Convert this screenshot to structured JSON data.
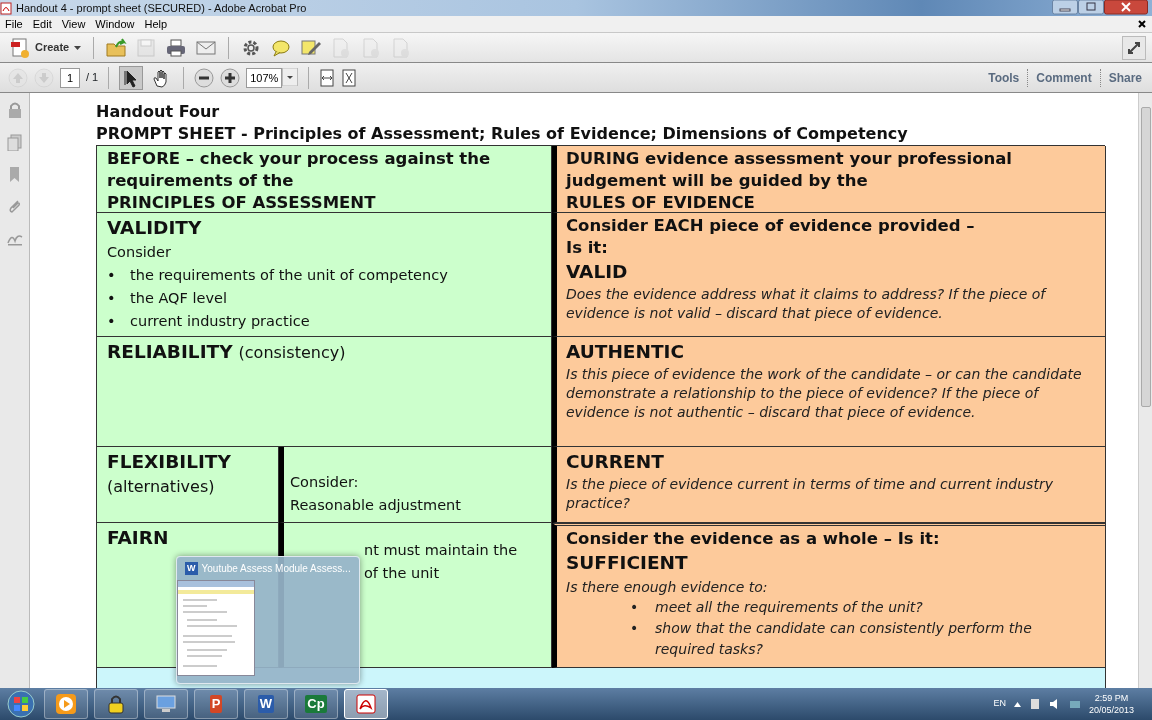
{
  "window": {
    "title": "Handout 4 - prompt sheet (SECURED) - Adobe Acrobat Pro"
  },
  "menu": [
    "File",
    "Edit",
    "View",
    "Window",
    "Help"
  ],
  "toolbar": {
    "create_label": "Create",
    "buttons": [
      {
        "kind": "open",
        "disabled": false
      },
      {
        "kind": "save",
        "disabled": true
      },
      {
        "kind": "print",
        "disabled": false
      },
      {
        "kind": "email",
        "disabled": false
      },
      {
        "kind": "gear",
        "disabled": false
      },
      {
        "kind": "comment",
        "disabled": false
      },
      {
        "kind": "sign",
        "disabled": false
      },
      {
        "kind": "doc",
        "disabled": true
      },
      {
        "kind": "doc",
        "disabled": true
      },
      {
        "kind": "doc",
        "disabled": true
      }
    ]
  },
  "nav": {
    "page": "1",
    "page_count": "/ 1",
    "zoom": "107%",
    "arrows": [
      {
        "kind": "up",
        "disabled": true
      },
      {
        "kind": "down",
        "disabled": true
      }
    ],
    "tools": [
      {
        "kind": "select",
        "selected": true
      },
      {
        "kind": "hand",
        "selected": false
      }
    ],
    "panes": [
      "Tools",
      "Comment",
      "Share"
    ]
  },
  "document": {
    "heading": "Handout Four",
    "subheading": "PROMPT SHEET - Principles of Assessment; Rules of Evidence; Dimensions of Competency",
    "left_header": [
      "BEFORE – check your process against the",
      "requirements of the",
      "PRINCIPLES OF ASSESSMENT"
    ],
    "right_header": [
      "DURING evidence assessment your professional",
      "judgement will be guided by the",
      "RULES OF EVIDENCE"
    ],
    "validity": {
      "title": "VALIDITY",
      "intro": "Consider",
      "bullets": [
        {
          "marker": "•",
          "text": "the requirements of the unit of competency"
        },
        {
          "marker": "•",
          "text": "the AQF level"
        },
        {
          "marker": "•",
          "text": "current industry practice"
        }
      ]
    },
    "reliability": {
      "title": "RELIABILITY",
      "note": "(consistency)"
    },
    "flexibility": {
      "title": "FLEXIBILITY",
      "note": "(alternatives)",
      "detail": [
        "Consider:",
        "Reasonable adjustment"
      ]
    },
    "fairness": {
      "title": "FAIRN",
      "detail": [
        "nt must maintain the",
        "of the unit"
      ]
    },
    "valid": {
      "lead": "Consider EACH piece of evidence provided –",
      "question": "Is it:",
      "title": "VALID",
      "desc": "Does the evidence address what it claims to address?  If the piece of evidence is not valid – discard that piece of evidence."
    },
    "authentic": {
      "title": "AUTHENTIC",
      "desc": "Is this piece of evidence the work of the candidate – or can the candidate demonstrate a relationship to the piece of evidence?  If the piece of evidence is not authentic – discard that piece of evidence."
    },
    "current": {
      "title": "CURRENT",
      "desc": "Is the piece of evidence current in terms of time and current industry practice?"
    },
    "sufficient": {
      "lead": "Consider the evidence as a whole – Is it:",
      "title": "SUFFICIENT",
      "desc": "Is there enough evidence to:",
      "bullets": [
        {
          "marker": "•",
          "text": "meet all the requirements of the unit?"
        },
        {
          "marker": "•",
          "text": "show that the candidate can consistently perform the required tasks?"
        }
      ]
    }
  },
  "popup": {
    "app_glyph": "W",
    "title": "Youtube Assess Module Assess..."
  },
  "taskbar": {
    "apps": [
      {
        "kind": "media",
        "selected": false
      },
      {
        "kind": "lock",
        "selected": false
      },
      {
        "kind": "computer",
        "selected": false
      },
      {
        "kind": "powerpoint",
        "glyph": "P",
        "selected": false
      },
      {
        "kind": "word",
        "glyph": "W",
        "selected": false
      },
      {
        "kind": "captivate",
        "glyph": "Cp",
        "selected": false
      },
      {
        "kind": "acrobat",
        "selected": true
      }
    ],
    "language": "EN",
    "time": "2:59 PM",
    "date": "20/05/2013"
  }
}
